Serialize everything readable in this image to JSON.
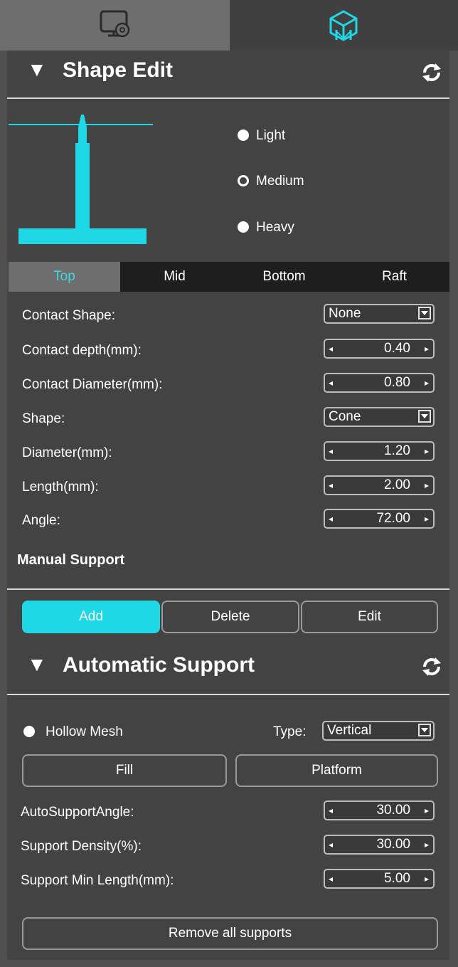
{
  "icons": {
    "settings_tab": "monitor-gear-icon",
    "support_tab": "support-structure-icon",
    "refresh": "refresh-icon",
    "collapse": "collapse-arrow-icon"
  },
  "colors": {
    "accent": "#1fd8e6",
    "panel": "#434343",
    "background": "#505050"
  },
  "shape_edit": {
    "arrow": "▼",
    "title": "Shape Edit",
    "presets": [
      {
        "label": "Light",
        "selected": false
      },
      {
        "label": "Medium",
        "selected": true
      },
      {
        "label": "Heavy",
        "selected": false
      }
    ],
    "tabs": [
      {
        "label": "Top",
        "active": true
      },
      {
        "label": "Mid",
        "active": false
      },
      {
        "label": "Bottom",
        "active": false
      },
      {
        "label": "Raft",
        "active": false
      }
    ],
    "fields": {
      "contact_shape": {
        "label": "Contact Shape:",
        "value": "None"
      },
      "contact_depth": {
        "label": "Contact depth(mm):",
        "value": "0.40"
      },
      "contact_diameter": {
        "label": "Contact Diameter(mm):",
        "value": "0.80"
      },
      "shape": {
        "label": "Shape:",
        "value": "Cone"
      },
      "diameter": {
        "label": "Diameter(mm):",
        "value": "1.20"
      },
      "length": {
        "label": "Length(mm):",
        "value": "2.00"
      },
      "angle": {
        "label": "Angle:",
        "value": "72.00"
      }
    }
  },
  "manual_support": {
    "title": "Manual Support",
    "buttons": {
      "add": "Add",
      "delete": "Delete",
      "edit": "Edit"
    }
  },
  "auto_support": {
    "arrow": "▼",
    "title": "Automatic Support",
    "hollow_mesh": "Hollow Mesh",
    "type_label": "Type:",
    "type_value": "Vertical",
    "fill": "Fill",
    "platform": "Platform",
    "fields": {
      "angle": {
        "label": "AutoSupportAngle:",
        "value": "30.00"
      },
      "density": {
        "label": "Support Density(%):",
        "value": "30.00"
      },
      "min_length": {
        "label": "Support Min Length(mm):",
        "value": "5.00"
      }
    },
    "remove_all": "Remove all supports"
  },
  "spin": {
    "left": "◂",
    "right": "▸"
  }
}
